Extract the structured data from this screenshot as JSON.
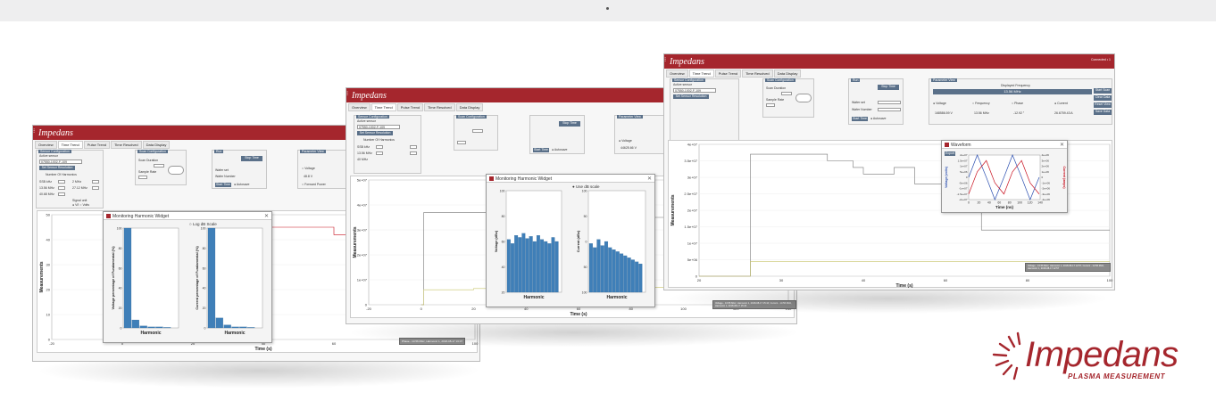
{
  "windows": {
    "left": {
      "brand": "Impedans",
      "tabs": [
        "Overview",
        "Time Trend",
        "Pulse Trend",
        "Time Resolved",
        "Data Display"
      ],
      "active_tab": "Time Trend",
      "sensor_group": "Sensor Configuration",
      "active_sensor": "Active sensor",
      "sensor_id": "07550-1002-F-109",
      "sensor_btn": "Set Sensor Resolution",
      "harmonics_label": "Number Of Harmonics",
      "freq_rows": [
        "SSB kHz",
        "13.56 MHz",
        "40.68 MHz"
      ],
      "freq_rows2": [
        "2 MHz",
        "27.12 MHz"
      ],
      "signal_unit": "Signal unit",
      "signal_opts": [
        "V/I",
        "Volts"
      ],
      "scan_group": "Scan Configuration",
      "scan_duration": "Scan Duration",
      "sample_rate": "Sample Rate",
      "run_label": "Run",
      "run_btn": "Stop Time",
      "wafer_set": "Wafer set",
      "wafer_number": "Wafer Number",
      "autosave": "Autosave",
      "start_btn": "Start Time",
      "param_view": "Parameter View",
      "param_opts": [
        "Voltage",
        "Forward Power"
      ],
      "param_vals": [
        "48.8 V"
      ],
      "ylabel": "Measurements",
      "xlabel": "Time (s)",
      "yticks": [
        "50",
        "40",
        "30",
        "20",
        "10",
        "0"
      ],
      "xticks": [
        "-20",
        "0",
        "20",
        "40",
        "60",
        "80",
        "100"
      ],
      "legend": "Phase - 13.56 MHz, Harmonic 1, 2018-08-17 16:07",
      "dialog_title": "Monitoring Harmonic Widget",
      "dialog_opts": [
        "Log dB Scale"
      ],
      "bar_left_ylabel": "Voltage percentage of Fundamental (%)",
      "bar_right_ylabel": "Current percentage of Fundamental (%)",
      "bar_xlabel": "Harmonic",
      "bar_yticks": [
        "100",
        "80",
        "60",
        "40",
        "20",
        "0"
      ]
    },
    "middle": {
      "brand": "Impedans",
      "tabs": [
        "Overview",
        "Time Trend",
        "Pulse Trend",
        "Time Resolved",
        "Data Display"
      ],
      "active_tab": "Time Trend",
      "sensor_group": "Sensor Configuration",
      "active_sensor": "Active sensor",
      "sensor_id": "07550-1002-F-109",
      "sensor_btn": "Set Sensor Resolution",
      "harmonics_label": "Number Of Harmonics",
      "freq_rows": [
        "SSB kHz",
        "13.56 MHz",
        "40 MHz"
      ],
      "scan_group": "Scan Configuration",
      "run_btn": "Stop Time",
      "start_btn": "Start Time",
      "autosave": "Autosave",
      "param_view": "Parameter View",
      "param_vals": [
        "Voltage",
        "44625.66 V"
      ],
      "ylabel": "Measurements",
      "xlabel": "Time (s)",
      "yticks": [
        "5e+07",
        "4e+07",
        "3e+07",
        "2e+07",
        "1e+07",
        "0"
      ],
      "xticks": [
        "-20",
        "0",
        "20",
        "40",
        "60",
        "80",
        "100",
        "120",
        "140"
      ],
      "legend": "Voltage - 13.56 MHz, Harmonic 1, 2018-08-17 15:44; Current - 13.56 MHz, Harmonic 1, 2018-08-17 15:44",
      "dialog_title": "Monitoring Harmonic Widget",
      "dialog_opts": [
        "Use dB scale"
      ],
      "bar_left_ylabel": "Voltage (dBc)",
      "bar_right_ylabel": "Current (dBc)",
      "bar_xlabel": "Harmonic",
      "bar_left_yticks": [
        "100",
        "80",
        "60",
        "40",
        "20"
      ],
      "bar_right_yticks": [
        "100",
        "50",
        "0",
        "50",
        "100"
      ]
    },
    "right": {
      "brand": "Impedans",
      "tabs": [
        "Overview",
        "Time Trend",
        "Pulse Trend",
        "Time Resolved",
        "Data Display"
      ],
      "active_tab": "Time Trend",
      "sensor_group": "Sensor Configuration",
      "active_sensor": "Active sensor",
      "sensor_id": "07550-1002-F-109",
      "sensor_btn": "Set Sensor Resolution",
      "scan_group": "Scan Configuration",
      "scan_duration": "Scan Duration",
      "sample_rate": "Sample Rate",
      "run_label": "Run",
      "run_btn": "Stop Time",
      "wafer_set": "Wafer set",
      "wafer_number": "Wafer Number",
      "start_btn": "Start Time",
      "autosave": "Autosave",
      "param_view": "Parameter View",
      "displayed_freq_label": "Displayed Frequency",
      "displayed_freq": "13.56 MHz",
      "param_opts": [
        "Voltage",
        "Frequency",
        "Phase",
        "Current"
      ],
      "param_vals": [
        "168586.59 V",
        "13.56 MHz",
        "-12.92 °",
        "26.6759.43 A"
      ],
      "side_buttons": [
        "Start Scan",
        "Clear Data",
        "Reset View",
        "Save Data"
      ],
      "ylabel": "Measurements",
      "xlabel": "Time (s)",
      "yticks": [
        "4e+07",
        "3.5e+07",
        "3e+07",
        "2.5e+07",
        "2e+07",
        "1.5e+07",
        "1e+07",
        "5e+06",
        "0"
      ],
      "xticks": [
        "20",
        "30",
        "40",
        "60",
        "80",
        "100"
      ],
      "legend": "Voltage - 13.56 MHz, Harmonic 1, 2018-08-17 12:57; Current - 13.56 MHz, Harmonic 1, 2018-08-17 12:57",
      "dialog_title": "Waveform",
      "dialog_btn": "Export",
      "wave_ylabel_left": "Voltage (volts)",
      "wave_ylabel_right": "Current (amps)",
      "wave_xlabel": "Time (ns)",
      "wave_xticks": [
        "0",
        "20",
        "40",
        "60",
        "80",
        "100",
        "120",
        "140"
      ],
      "wave_yticks_left": [
        "2e+07",
        "1.5e+07",
        "1e+07",
        "5e+06",
        "0",
        "-5e+06",
        "-1e+07",
        "-1.5e+07",
        "-2e+07"
      ],
      "wave_yticks_right": [
        "4e+06",
        "3e+06",
        "2e+06",
        "1e+06",
        "0",
        "-1e+06",
        "-2e+06",
        "-3e+06",
        "-4e+06"
      ],
      "corner": "Connected • 1"
    }
  },
  "logo": {
    "word": "Impedans",
    "sub": "PLASMA MEASUREMENT",
    "color": "#a5262d"
  },
  "chart_data": [
    {
      "type": "line",
      "title": "",
      "xlabel": "Time (s)",
      "ylabel": "Measurements",
      "xlim": [
        -20,
        100
      ],
      "ylim": [
        0,
        50
      ],
      "series": [
        {
          "name": "Phase - 13.56 MHz, Harmonic 1",
          "x": [
            42,
            55,
            60,
            65,
            70,
            75,
            80,
            85,
            88,
            100
          ],
          "y": [
            45,
            45,
            42,
            38,
            34,
            30,
            26,
            22,
            20,
            20
          ]
        }
      ]
    },
    {
      "type": "bar",
      "title": "",
      "xlabel": "Harmonic",
      "ylabel": "Voltage percentage of Fundamental (%)",
      "ylim": [
        0,
        100
      ],
      "categories": [
        "1",
        "2",
        "3",
        "4",
        "5",
        "6"
      ],
      "values": [
        100,
        8,
        2,
        1,
        1,
        0.5
      ]
    },
    {
      "type": "bar",
      "title": "",
      "xlabel": "Harmonic",
      "ylabel": "Current percentage of Fundamental (%)",
      "ylim": [
        0,
        100
      ],
      "categories": [
        "1",
        "2",
        "3",
        "4",
        "5",
        "6"
      ],
      "values": [
        100,
        10,
        3,
        1,
        1,
        0.5
      ]
    },
    {
      "type": "line",
      "title": "",
      "xlabel": "Time (s)",
      "ylabel": "Measurements",
      "xlim": [
        -20,
        140
      ],
      "ylim": [
        0,
        50000000
      ],
      "series": [
        {
          "name": "Voltage",
          "x": [
            0,
            1,
            20,
            40,
            60,
            80,
            100,
            120,
            140
          ],
          "y": [
            0,
            37000000,
            37000000,
            36000000,
            36000000,
            35000000,
            35000000,
            35000000,
            35000000
          ]
        },
        {
          "name": "Current",
          "x": [
            0,
            1,
            20,
            40,
            60,
            80,
            100,
            120,
            140
          ],
          "y": [
            0,
            6000000,
            6500000,
            7000000,
            7000000,
            7000000,
            7000000,
            7000000,
            7000000
          ]
        }
      ]
    },
    {
      "type": "bar",
      "title": "",
      "xlabel": "Harmonic",
      "ylabel": "Voltage (dBc)",
      "ylim": [
        0,
        100
      ],
      "categories": [
        "1",
        "2",
        "3",
        "4",
        "5",
        "6",
        "7",
        "8",
        "9",
        "10",
        "11",
        "12",
        "13",
        "14"
      ],
      "values": [
        52,
        48,
        56,
        54,
        58,
        53,
        55,
        50,
        56,
        52,
        50,
        48,
        54,
        50
      ]
    },
    {
      "type": "bar",
      "title": "",
      "xlabel": "Harmonic",
      "ylabel": "Current (dBc)",
      "ylim": [
        0,
        100
      ],
      "categories": [
        "1",
        "2",
        "3",
        "4",
        "5",
        "6",
        "7",
        "8",
        "9",
        "10",
        "11",
        "12",
        "13",
        "14"
      ],
      "values": [
        48,
        44,
        52,
        46,
        50,
        44,
        42,
        40,
        38,
        36,
        34,
        32,
        30,
        28
      ]
    },
    {
      "type": "line",
      "title": "",
      "xlabel": "Time (s)",
      "ylabel": "Measurements",
      "xlim": [
        20,
        100
      ],
      "ylim": [
        0,
        40000000
      ],
      "series": [
        {
          "name": "Voltage",
          "x": [
            20,
            30,
            40,
            45,
            50,
            52,
            55,
            58,
            62,
            70,
            75,
            80,
            100
          ],
          "y": [
            0,
            37000000,
            37000000,
            35000000,
            33000000,
            31000000,
            31000000,
            33000000,
            28000000,
            20000000,
            14000000,
            14000000,
            14000000
          ]
        },
        {
          "name": "Current",
          "x": [
            20,
            30,
            40,
            60,
            80,
            100
          ],
          "y": [
            0,
            4500000,
            4500000,
            4500000,
            4500000,
            4500000
          ]
        }
      ]
    },
    {
      "type": "line",
      "title": "",
      "xlabel": "Time (ns)",
      "ylabel": "Voltage (volts)",
      "xlim": [
        0,
        150
      ],
      "ylim": [
        -20000000,
        20000000
      ],
      "series": [
        {
          "name": "Voltage",
          "x": [
            0,
            18,
            37,
            55,
            74,
            92,
            111,
            129,
            148
          ],
          "y": [
            0,
            20000000,
            0,
            -20000000,
            0,
            20000000,
            0,
            -20000000,
            0
          ]
        },
        {
          "name": "Current",
          "x": [
            0,
            18,
            37,
            55,
            74,
            92,
            111,
            129,
            148
          ],
          "y": [
            -15000000,
            5000000,
            15000000,
            -5000000,
            -15000000,
            5000000,
            15000000,
            -5000000,
            -15000000
          ]
        }
      ]
    }
  ]
}
